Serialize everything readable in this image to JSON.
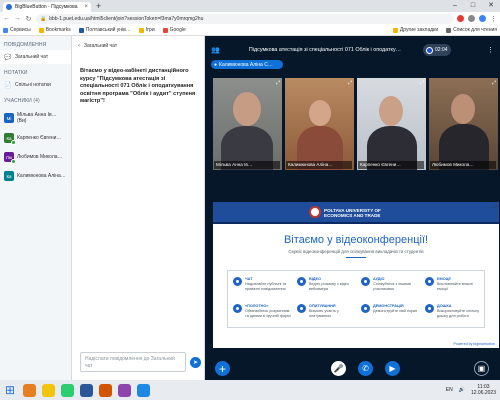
{
  "browser": {
    "tab_title": "BigBlueButton - Підсумкова",
    "url": "bbb-1.puet.edu.ua/html5client/join?sessionToken=f3ma7y0mrqmg2hu",
    "bookmarks": [
      "Сервисы",
      "Bookmarks",
      "Полтавський унів…",
      "Ігри",
      "Google"
    ],
    "bookmarks_right": [
      "Другие закладки",
      "Список для чтения"
    ]
  },
  "sidebar": {
    "messages_heading": "ПОВІДОМЛЕННЯ",
    "public_chat": "Загальний чат",
    "notes_heading": "НОТАТКИ",
    "shared_notes": "Спільні нотатки",
    "participants_heading": "УЧАСНИКИ (4)",
    "users": [
      {
        "initials": "Мі",
        "name": "Мільва Анна Ів… (Ви)",
        "color": "#1565c0"
      },
      {
        "initials": "Ка",
        "name": "Карпенко Євгени…",
        "color": "#2e7d32"
      },
      {
        "initials": "Лю",
        "name": "Любимов Микола…",
        "color": "#6a1b9a"
      },
      {
        "initials": "Ка",
        "name": "Калимюнова Аліна…",
        "color": "#00838f"
      }
    ]
  },
  "chat": {
    "header": "Загальний чат",
    "welcome": "Вітаємо у відео-кабінеті дистанційного курсу \"Підсумкова атестація зі спеціальності 071 Облік і оподаткування освітня програма \"Облік і аудит\" ступеня магістр\"!",
    "input_placeholder": "Надіслати повідомлення до Загальний чат"
  },
  "main": {
    "title": "Підсумкова атестація зі спеціальності 071 Облік і оподатку…",
    "recording_time": "02:04",
    "presenter_name": "Калимюнова Аліна С…",
    "webcams": [
      {
        "name": "Мільва Анна Ів…"
      },
      {
        "name": "Калимюнова Аліна…"
      },
      {
        "name": "Карпенко Євгени…"
      },
      {
        "name": "Любимов Микола…"
      }
    ],
    "whiteboard": {
      "uni_line1": "POLTAVA UNIVERSITY OF",
      "uni_line2": "ECONOMICS AND TRADE",
      "title": "Вітаємо у відеоконференції!",
      "subtitle": "Сервіс відеоконференцій для спілкування викладачів та студентів",
      "features": [
        {
          "title": "ЧАТ",
          "text": "Надсилайте публічні та приватні повідомлення"
        },
        {
          "title": "ВІДЕО",
          "text": "Ведіть розмову з відео вебкамери"
        },
        {
          "title": "АУДІО",
          "text": "Спілкуйтеся з іншими учасниками"
        },
        {
          "title": "ЕМОЦІЇ",
          "text": "Висловлюйте власні емоції"
        },
        {
          "title": "«ПОЛОТНО»",
          "text": "Обмінюйтесь розумінням та ідеями в зручній формі"
        },
        {
          "title": "ОПИТУВАННЯ",
          "text": "Візьміть участь у опитуваннях"
        },
        {
          "title": "ДЕМОНСТРАЦІЯ",
          "text": "Демонструйте свій екран"
        },
        {
          "title": "ДОШКА",
          "text": "Використовуйте спільну дошку для роботи"
        }
      ],
      "powered": "Powered by bigbluebutton"
    }
  },
  "taskbar": {
    "lang": "EN",
    "time": "11:03",
    "date": "12.06.2023"
  }
}
